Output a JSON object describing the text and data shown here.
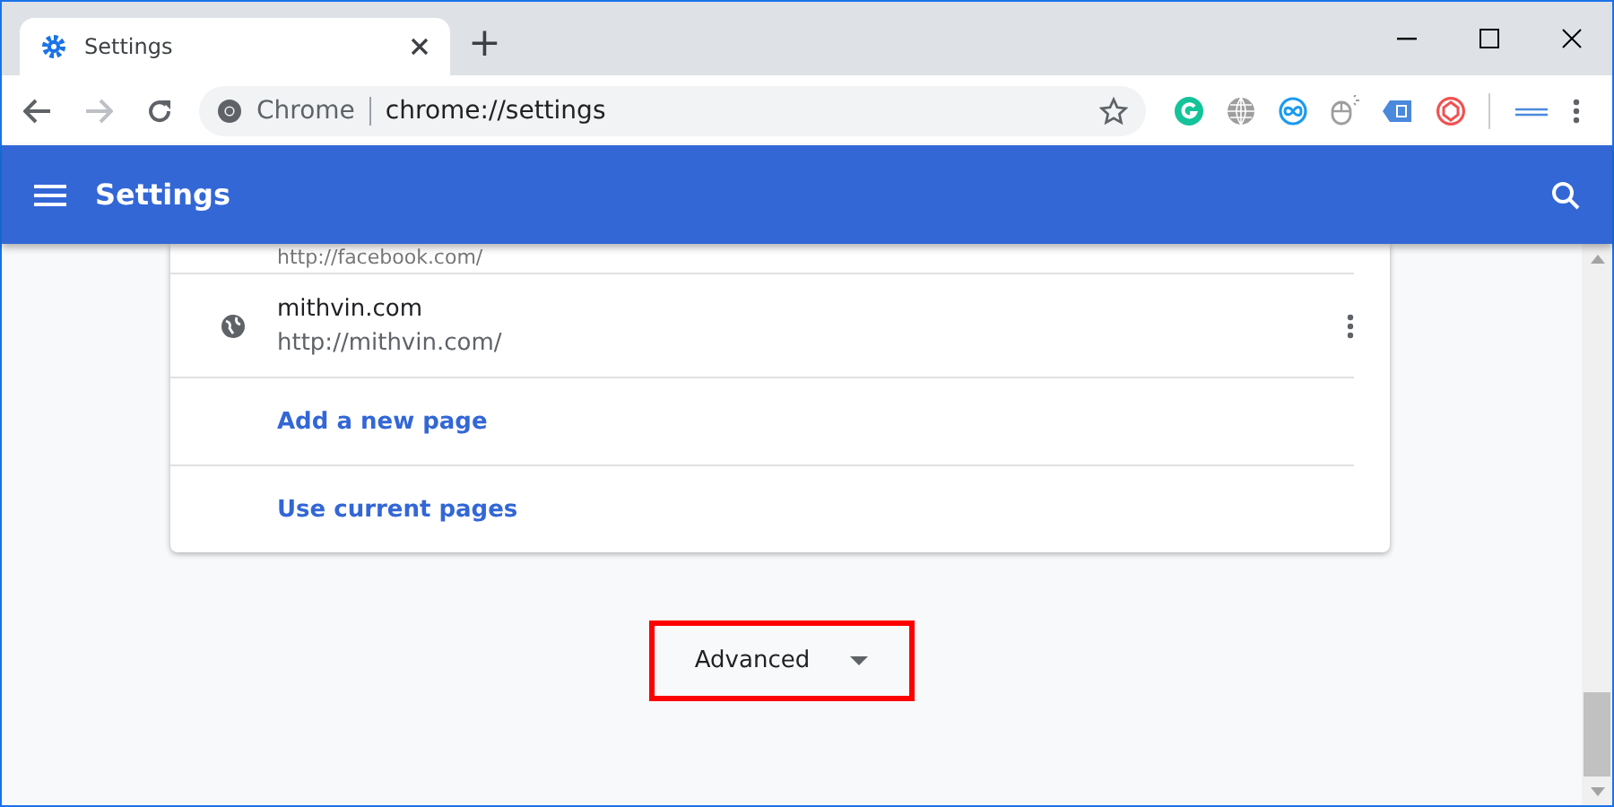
{
  "window": {
    "tab_title": "Settings",
    "new_tab": "+"
  },
  "toolbar": {
    "omnibox_label": "Chrome",
    "url": "chrome://settings",
    "bookmarked": false
  },
  "header": {
    "title": "Settings"
  },
  "pages": [
    {
      "kind": "partial",
      "url": "http://facebook.com/"
    },
    {
      "kind": "site",
      "name": "mithvin.com",
      "url": "http://mithvin.com/"
    },
    {
      "kind": "link",
      "label": "Add a new page"
    },
    {
      "kind": "link",
      "label": "Use current pages"
    }
  ],
  "advanced": {
    "label": "Advanced",
    "expanded": false,
    "highlighted": true
  }
}
